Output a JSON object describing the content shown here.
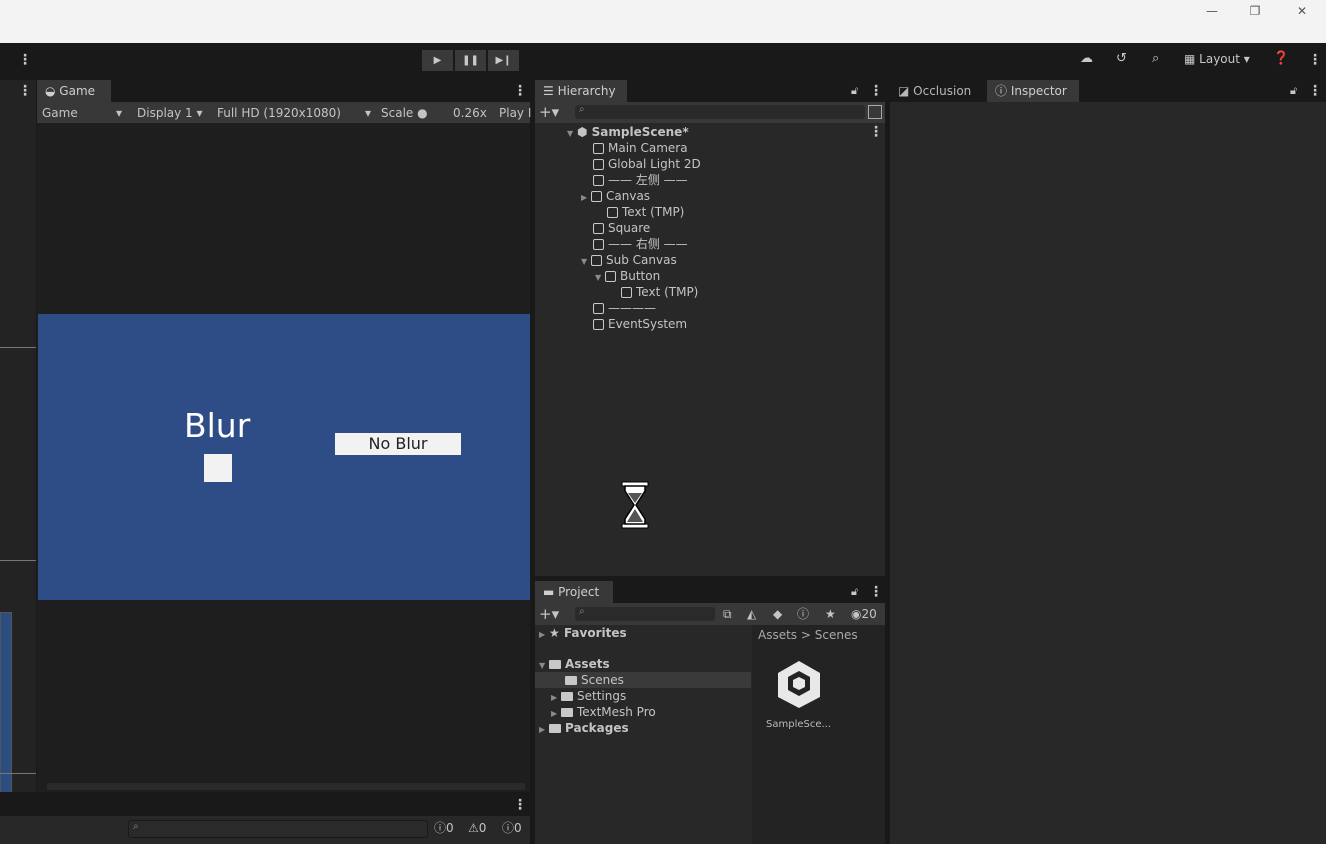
{
  "window": {
    "minimize": "—",
    "maximize": "❐",
    "close": "✕"
  },
  "toolbar": {
    "layout_label": "Layout",
    "play": "▶",
    "pause": "❚❚",
    "step": "▶❙"
  },
  "game_panel": {
    "tab_label": "Game",
    "mode": "Game",
    "display": "Display 1",
    "resolution": "Full HD (1920x1080)",
    "scale_label": "Scale",
    "scale_value": "0.26x",
    "play_label": "Play I",
    "blur_text": "Blur",
    "noblur_text": "No Blur",
    "canvas_color": "#2e4d86"
  },
  "hierarchy": {
    "tab_label": "Hierarchy",
    "items": [
      {
        "label": "SampleScene*"
      },
      {
        "label": "Main Camera"
      },
      {
        "label": "Global Light 2D"
      },
      {
        "label": "—— 左侧 ——"
      },
      {
        "label": "Canvas"
      },
      {
        "label": "Text (TMP)"
      },
      {
        "label": "Square"
      },
      {
        "label": "—— 右侧 ——"
      },
      {
        "label": "Sub Canvas"
      },
      {
        "label": "Button"
      },
      {
        "label": "Text (TMP)"
      },
      {
        "label": "————"
      },
      {
        "label": "EventSystem"
      }
    ]
  },
  "inspector": {
    "tab_occlusion": "Occlusion",
    "tab_inspector": "Inspector"
  },
  "project": {
    "tab_label": "Project",
    "hidden_count": "20",
    "favorites": "Favorites",
    "assets": "Assets",
    "folders": [
      "Scenes",
      "Settings",
      "TextMesh Pro"
    ],
    "packages": "Packages",
    "breadcrumb_root": "Assets",
    "breadcrumb_sep": ">",
    "breadcrumb_current": "Scenes",
    "file_label": "SampleSce..."
  },
  "console": {
    "info_count": "0",
    "warn_count": "0",
    "error_count": "0"
  }
}
